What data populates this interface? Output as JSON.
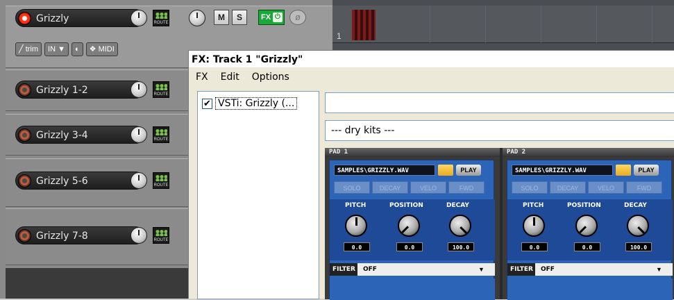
{
  "tracks": [
    {
      "name": "Grizzly",
      "armed": true
    },
    {
      "name": "Grizzly 1-2",
      "armed": false
    },
    {
      "name": "Grizzly 3-4",
      "armed": false
    },
    {
      "name": "Grizzly 5-6",
      "armed": false
    },
    {
      "name": "Grizzly 7-8",
      "armed": false
    }
  ],
  "track1_buttons": {
    "mute": "M",
    "solo": "S",
    "fx": "FX",
    "power": "⏻",
    "phase": "ø",
    "route": "ROUTE"
  },
  "track1_row2": {
    "trim": "trim",
    "in": "IN",
    "midi": "MIDI"
  },
  "arrange": {
    "track_number": "1"
  },
  "fx_window": {
    "title": "FX: Track 1 \"Grizzly\"",
    "menu": [
      "FX",
      "Edit",
      "Options"
    ],
    "fx_item": "VSTi: Grizzly (...",
    "fx_checked": true,
    "kit": "--- dry kits ---"
  },
  "pads": [
    {
      "header": "PAD 1",
      "sample": "SAMPLES\\GRIZZLY.WAV",
      "play": "PLAY",
      "modes": [
        "SOLO",
        "DECAY",
        "VELO",
        "FWD"
      ],
      "controls": [
        {
          "label": "PITCH",
          "value": "0.0"
        },
        {
          "label": "POSITION",
          "value": "0.0"
        },
        {
          "label": "DECAY",
          "value": "100.0"
        }
      ],
      "filter_label": "FILTER",
      "filter_value": "OFF"
    },
    {
      "header": "PAD 2",
      "sample": "SAMPLES\\GRIZZLY.WAV",
      "play": "PLAY",
      "modes": [
        "SOLO",
        "DECAY",
        "VELO",
        "FWD"
      ],
      "controls": [
        {
          "label": "PITCH",
          "value": "0.0"
        },
        {
          "label": "POSITION",
          "value": "0.0"
        },
        {
          "label": "DECAY",
          "value": "100.0"
        }
      ],
      "filter_label": "FILTER",
      "filter_value": "OFF"
    }
  ]
}
